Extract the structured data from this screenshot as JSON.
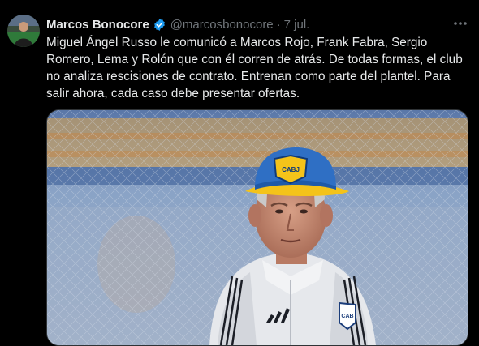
{
  "tweet": {
    "author_name": "Marcos Bonocore",
    "author_handle": "@marcosbonocore",
    "separator": "·",
    "date": "7 jul.",
    "text": "Miguel Ángel Russo le comunicó a Marcos Rojo, Frank Fabra, Sergio Romero, Lema y Rolón que con él corren de atrás. De todas formas, el club no analiza rescisiones de contrato. Entrenan como parte del plantel. Para salir ahora, cada caso debe presentar ofertas.",
    "verified": true,
    "more_icon": "more-horizontal-icon"
  },
  "media": {
    "cap_badge_text": "CABJ",
    "jacket_badge_text": "CAB",
    "colors": {
      "cap_blue": "#2f6fc4",
      "cap_yellow": "#f4c31a",
      "jacket": "#e6e8ec",
      "background_blue": "#7f98bd"
    }
  },
  "colors": {
    "background": "#000000",
    "text_primary": "#e7e9ea",
    "text_secondary": "#71767b",
    "verified_blue": "#1d9bf0"
  }
}
